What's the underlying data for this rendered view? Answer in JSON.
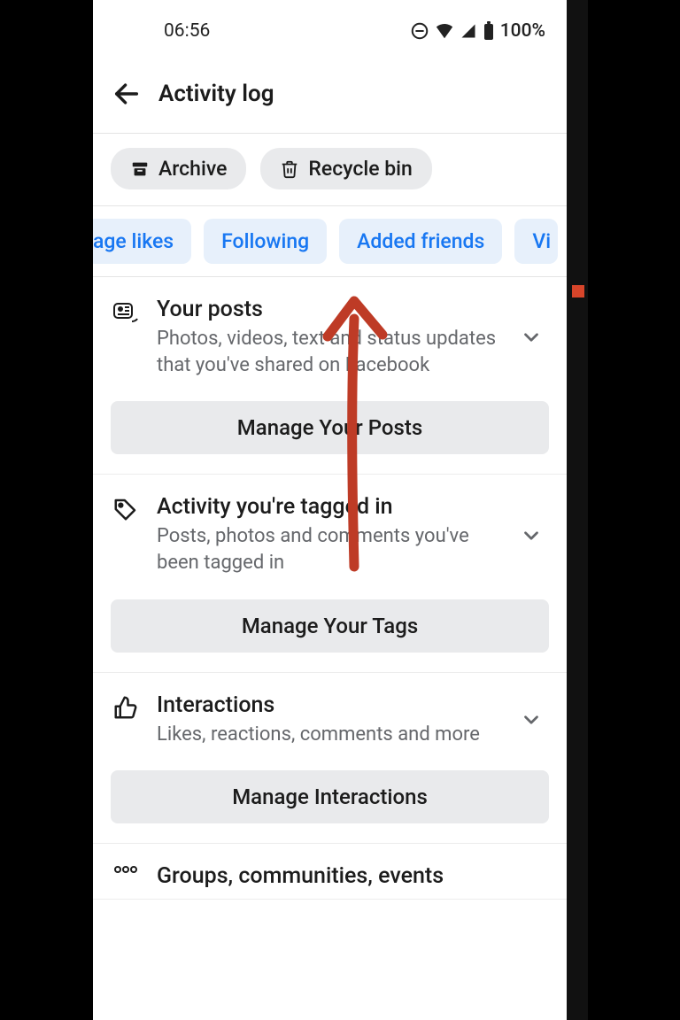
{
  "statusbar": {
    "time": "06:56",
    "battery": "100%"
  },
  "header": {
    "title": "Activity log"
  },
  "quick": {
    "archive": "Archive",
    "recycle": "Recycle bin"
  },
  "filters": {
    "page_likes": "age likes",
    "following": "Following",
    "added_friends": "Added friends",
    "videos": "Vi"
  },
  "sections": [
    {
      "title": "Your posts",
      "desc": "Photos, videos, text and status updates that you've shared on Facebook",
      "button": "Manage Your Posts"
    },
    {
      "title": "Activity you're tagged in",
      "desc": "Posts, photos and comments you've been tagged in",
      "button": "Manage Your Tags"
    },
    {
      "title": "Interactions",
      "desc": "Likes, reactions, comments and more",
      "button": "Manage Interactions"
    },
    {
      "title": "Groups, communities, events",
      "desc": ""
    }
  ]
}
